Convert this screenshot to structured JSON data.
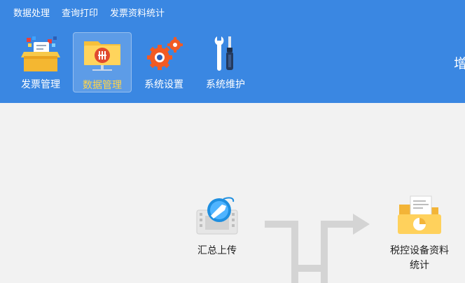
{
  "menubar": {
    "items": [
      "数据处理",
      "查询打印",
      "发票资料统计"
    ]
  },
  "toolbar": {
    "tools": [
      {
        "label": "发票管理",
        "icon": "invoice-box-icon",
        "active": false
      },
      {
        "label": "数据管理",
        "icon": "data-folder-icon",
        "active": true
      },
      {
        "label": "系统设置",
        "icon": "gears-icon",
        "active": false
      },
      {
        "label": "系统维护",
        "icon": "wrench-screwdriver-icon",
        "active": false
      }
    ],
    "right_cut_text": "增"
  },
  "flow": {
    "summary_upload": {
      "label": "汇总上传",
      "icon": "upload-globe-icon"
    },
    "device_stats": {
      "label_line1": "税控设备资料",
      "label_line2": "统计",
      "icon": "report-folder-icon"
    }
  },
  "colors": {
    "header_bg": "#3a87e2",
    "active_label": "#ffd54a",
    "main_bg": "#f2f2f2",
    "flow_line": "#d4d4d4"
  }
}
